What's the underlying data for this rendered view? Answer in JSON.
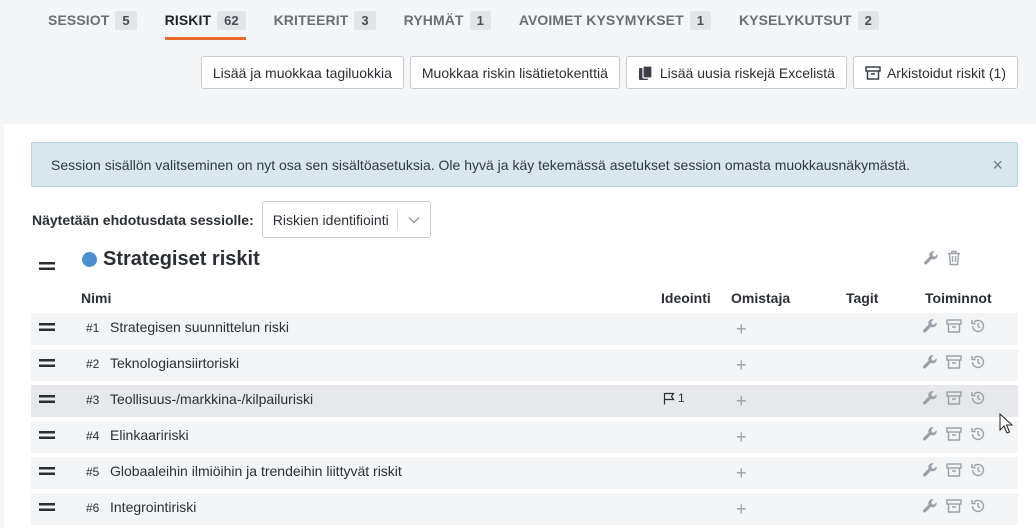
{
  "tabs": [
    {
      "label": "SESSIOT",
      "count": "5"
    },
    {
      "label": "RISKIT",
      "count": "62"
    },
    {
      "label": "KRITEERIT",
      "count": "3"
    },
    {
      "label": "RYHMÄT",
      "count": "1"
    },
    {
      "label": "AVOIMET KYSYMYKSET",
      "count": "1"
    },
    {
      "label": "KYSELYKUTSUT",
      "count": "2"
    }
  ],
  "active_tab": "RISKIT",
  "toolbar": {
    "tag_classes": "Lisää ja muokkaa tagiluokkia",
    "extra_fields": "Muokkaa riskin lisätietokenttiä",
    "import_excel": "Lisää uusia riskejä Excelistä",
    "archived": "Arkistoidut riskit (1)"
  },
  "alert": {
    "text": "Session sisällön valitseminen on nyt osa sen sisältöasetuksia. Ole hyvä ja käy tekemässä asetukset session omasta muokkausnäkymästä.",
    "close": "×"
  },
  "session_select": {
    "label": "Näytetään ehdotusdata sessiolle:",
    "value": "Riskien identifiointi"
  },
  "group": {
    "title": "Strategiset riskit",
    "color": "#4a90d0"
  },
  "columns": {
    "name": "Nimi",
    "ideation": "Ideointi",
    "owner": "Omistaja",
    "tags": "Tagit",
    "actions": "Toiminnot"
  },
  "risks": [
    {
      "num": "#1",
      "name": "Strategisen suunnittelun riski",
      "ideas": ""
    },
    {
      "num": "#2",
      "name": "Teknologiansiirtoriski",
      "ideas": ""
    },
    {
      "num": "#3",
      "name": "Teollisuus-/markkina-/kilpailuriski",
      "ideas": "1"
    },
    {
      "num": "#4",
      "name": "Elinkaaririski",
      "ideas": ""
    },
    {
      "num": "#5",
      "name": "Globaaleihin ilmiöihin ja trendeihin liittyvät riskit",
      "ideas": ""
    },
    {
      "num": "#6",
      "name": "Integrointiriski",
      "ideas": ""
    }
  ],
  "add_symbol": "+",
  "colors": {
    "accent": "#e8692a",
    "alert_bg": "#d8e7ec",
    "row_bg": "#f3f4f6"
  },
  "icons": {
    "drag": "drag-handle-icon",
    "wrench": "wrench-icon",
    "trash": "trash-icon",
    "archive": "archive-icon",
    "history": "history-icon",
    "flag": "flag-icon",
    "chevron": "chevron-down-icon",
    "copy": "copy-icon"
  }
}
